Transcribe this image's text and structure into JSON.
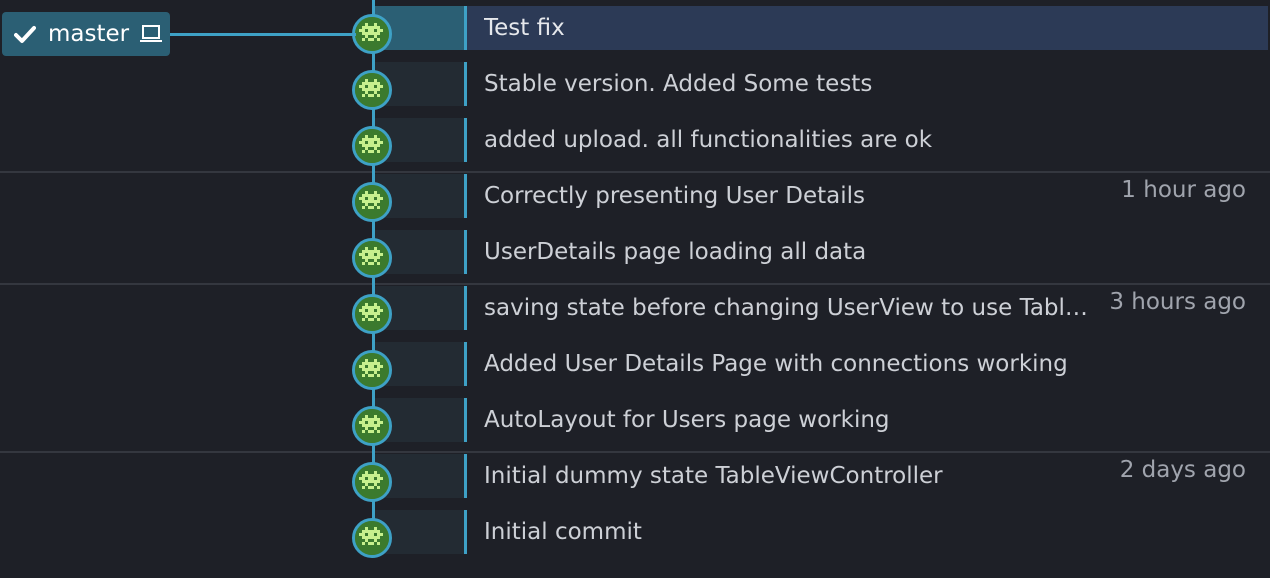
{
  "branch": {
    "name": "master",
    "icons": [
      "check-icon",
      "computer-icon"
    ]
  },
  "commits": [
    {
      "message": "Test fix",
      "time": "",
      "selected": true
    },
    {
      "message": "Stable version. Added Some tests",
      "time": ""
    },
    {
      "message": "added upload. all functionalities are ok",
      "time": ""
    },
    {
      "message": "Correctly presenting User Details",
      "time": "1 hour ago"
    },
    {
      "message": "UserDetails page loading all data",
      "time": ""
    },
    {
      "message": "saving state before changing UserView to use TableViewController",
      "time": "3 hours ago"
    },
    {
      "message": "Added User Details Page with connections working",
      "time": ""
    },
    {
      "message": "AutoLayout for Users page working",
      "time": ""
    },
    {
      "message": "Initial dummy state TableViewController",
      "time": "2 days ago"
    },
    {
      "message": "Initial commit",
      "time": ""
    }
  ],
  "colors": {
    "background": "#1e2027",
    "accent": "#3ea1c6",
    "selected_row": "#2c3a56",
    "branch_badge": "#2b5f74",
    "avatar_green": "#3b7a2e"
  }
}
